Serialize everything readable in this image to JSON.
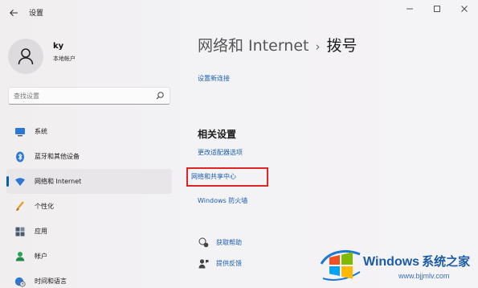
{
  "window": {
    "title": "设置",
    "back_icon": "back-arrow-icon",
    "caption_icons": [
      "minimize-icon",
      "maximize-icon",
      "close-icon"
    ]
  },
  "user": {
    "name": "ky",
    "account_type": "本地帐户"
  },
  "search": {
    "placeholder": "查找设置"
  },
  "sidebar": {
    "items": [
      {
        "label": "系统",
        "icon": "monitor-icon",
        "active": false
      },
      {
        "label": "蓝牙和其他设备",
        "icon": "bluetooth-icon",
        "active": false
      },
      {
        "label": "网络和 Internet",
        "icon": "wifi-icon",
        "active": true
      },
      {
        "label": "个性化",
        "icon": "brush-icon",
        "active": false
      },
      {
        "label": "应用",
        "icon": "apps-icon",
        "active": false
      },
      {
        "label": "帐户",
        "icon": "person-icon",
        "active": false
      },
      {
        "label": "时间和语言",
        "icon": "globe-clock-icon",
        "active": false
      }
    ]
  },
  "main": {
    "breadcrumb_parent": "网络和 Internet",
    "breadcrumb_separator": "›",
    "breadcrumb_current": "拨号",
    "setup_link": "设置新连接",
    "related_title": "相关设置",
    "related_links": {
      "adapter": "更改适配器选项",
      "sharing_center": "网络和共享中心",
      "firewall": "Windows 防火墙"
    },
    "help": {
      "get_help": "获取帮助",
      "feedback": "提供反馈"
    }
  },
  "watermark": {
    "brand": "Windows",
    "brand_cn": "系统之家",
    "url": "www.bjjmlv.com"
  },
  "colors": {
    "accent": "#0063b1",
    "link": "#1a5fb4",
    "highlight": "#e02525"
  }
}
